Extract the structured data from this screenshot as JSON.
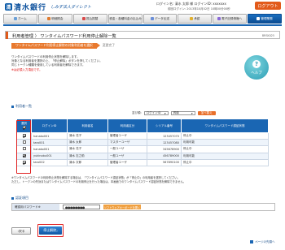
{
  "header": {
    "logo_mark": "清",
    "bank_name": "清水銀行",
    "service_name": "しみず法人ダイレクト",
    "login_info": "ログイン名: 清水 太郎 様  ログインID: xxxxxxx",
    "last_login": "前回ログイン: 2013年10月02日 10時00分00秒",
    "logout_label": "ログアウト"
  },
  "nav": {
    "items": [
      {
        "label": "ホーム",
        "color": "#6aa0d8"
      },
      {
        "label": "明細照会",
        "color": "#e07a2e"
      },
      {
        "label": "振込振替",
        "color": "#d84a4a"
      },
      {
        "label": "税金・各種料金の払込み",
        "color": "#5cb85c"
      },
      {
        "label": "データ伝送",
        "color": "#6a8ed8"
      },
      {
        "label": "承認",
        "color": "#e0b030"
      },
      {
        "label": "電子記録債権へ",
        "color": "#8a6ad8"
      },
      {
        "label": "管理業務",
        "color": "#ffffff"
      }
    ],
    "active_index": 7
  },
  "title": {
    "text": "利用者管理 〉 ワンタイムパスワード利用停止解除一覧",
    "code": "BRSK025"
  },
  "steps": {
    "current": "ワンタイムパスワード利用停止解除の対象利用者を選択",
    "next": "変更完了"
  },
  "description": {
    "lines": [
      "ワンタイムパスワードの利用停止状態を解除します。",
      "対象となる利用者を選択の上、「停止解除」ボタンを押してください。",
      "同じトークン種類を使用している利用者を解除できます。"
    ],
    "required_note": "※は必須入力項目です。"
  },
  "help_label": "ヘルプ",
  "help_glyph": "?",
  "list_section_title": "利用者一覧",
  "sort": {
    "label": "並び順:",
    "field": "ログインID",
    "order": "昇順",
    "button": "並べ替え"
  },
  "table": {
    "headers": [
      "選択",
      "ログインID",
      "利用者名",
      "利用者区分",
      "シリアル番号",
      "ワンタイムパスワード認証状態"
    ],
    "select_all_checked": true,
    "rows": [
      {
        "checked": true,
        "login_id": "hanako001",
        "name": "清水 花子",
        "role": "管理者ユーザ",
        "serial": "123457070",
        "status": "停止中"
      },
      {
        "checked": false,
        "login_id": "taro001",
        "name": "清水 太郎",
        "role": "マスターユーザ",
        "serial": "123457080",
        "status": "利用可能"
      },
      {
        "checked": false,
        "login_id": "hanako001",
        "name": "清水 花子",
        "role": "一般ユーザ",
        "serial": "345678900",
        "status": "停止中"
      },
      {
        "checked": true,
        "login_id": "yukinobu001",
        "name": "清水 志之助",
        "role": "一般ユーザ",
        "serial": "456789000",
        "status": "利用可能"
      },
      {
        "checked": true,
        "login_id": "taro002",
        "name": "清水 次郎",
        "role": "管理者ユーザ",
        "serial": "567890100",
        "status": "停止中"
      }
    ]
  },
  "notes": [
    "※ワンタイムパスワードの利用停止状態を解除する場合は、「ワンタイムパスワード認証状態」が「停止中」の利用者を選択してください。",
    "ただし、トークンの失効またはワンタイムパスワードの利用停止を行った場合は、本画面でのワンタイムパスワード認証状態を解除できません。"
  ],
  "auth_section_title": "認証項目",
  "auth": {
    "label": "確認用パスワード※",
    "value_mask": "●●●●●●●●",
    "keyboard_label": "ソフトウェアキーボードを開く"
  },
  "buttons": {
    "back": "戻る",
    "submit": "停止解除"
  },
  "page_top": "ページの先頭へ"
}
